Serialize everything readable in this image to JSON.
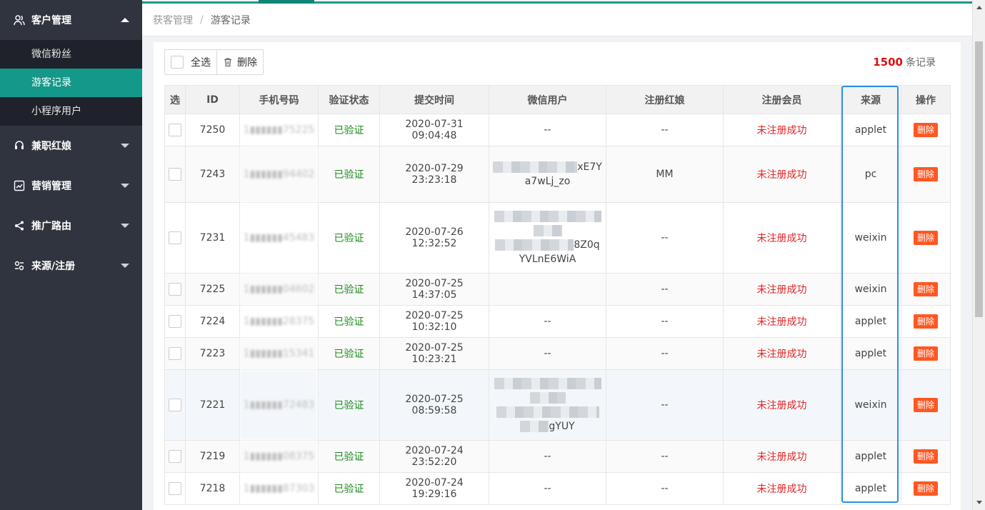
{
  "colors": {
    "sidebar_bg": "#30343f",
    "submenu_bg": "#1f222a",
    "accent": "#14988a",
    "verified": "#1a8a1a",
    "unregistered": "#e42525",
    "delete_btn": "#ff5722",
    "highlight": "#2a8fe6"
  },
  "sidebar": {
    "groups": [
      {
        "label": "客户管理",
        "icon": "users-icon",
        "expanded": true,
        "items": [
          {
            "label": "微信粉丝"
          },
          {
            "label": "游客记录",
            "active": true
          },
          {
            "label": "小程序用户"
          }
        ]
      },
      {
        "label": "兼职红娘",
        "icon": "headset-icon",
        "expanded": false
      },
      {
        "label": "营销管理",
        "icon": "chart-icon",
        "expanded": false
      },
      {
        "label": "推广路由",
        "icon": "share-icon",
        "expanded": false
      },
      {
        "label": "来源/注册",
        "icon": "source-icon",
        "expanded": false
      }
    ]
  },
  "breadcrumb": {
    "parent": "获客管理",
    "separator": "/",
    "current": "游客记录"
  },
  "toolbar": {
    "select_all": "全选",
    "delete": "删除"
  },
  "records": {
    "count": "1500",
    "suffix": "条记录"
  },
  "table": {
    "headers": [
      "选",
      "ID",
      "手机号码",
      "验证状态",
      "提交时间",
      "微信用户",
      "注册红娘",
      "注册会员",
      "来源",
      "操作"
    ],
    "rows": [
      {
        "id": "7250",
        "phone": "1▮▮▮▮▮▮75225",
        "status": "已验证",
        "time": "2020-07-31 09:04:48",
        "wechat": "--",
        "matchmaker": "--",
        "member": "未注册成功",
        "source": "applet",
        "action": "删除"
      },
      {
        "id": "7243",
        "phone": "1▮▮▮▮▮▮94402",
        "status": "已验证",
        "time": "2020-07-29 23:23:18",
        "wechat_tail1": "xE7Y",
        "wechat_tail2": "a7wLj_zo",
        "matchmaker": "MM",
        "member": "未注册成功",
        "source": "pc",
        "action": "删除"
      },
      {
        "id": "7231",
        "phone": "1▮▮▮▮▮▮45483",
        "status": "已验证",
        "time": "2020-07-26 12:32:52",
        "wechat_tail1": "8Z0q",
        "wechat_tail2": "YVLnE6WiA",
        "matchmaker": "--",
        "member": "未注册成功",
        "source": "weixin",
        "action": "删除"
      },
      {
        "id": "7225",
        "phone": "1▮▮▮▮▮▮04602",
        "status": "已验证",
        "time": "2020-07-25 14:37:05",
        "wechat": "",
        "matchmaker": "--",
        "member": "未注册成功",
        "source": "weixin",
        "action": "删除"
      },
      {
        "id": "7224",
        "phone": "1▮▮▮▮▮▮28375",
        "status": "已验证",
        "time": "2020-07-25 10:32:10",
        "wechat": "--",
        "matchmaker": "--",
        "member": "未注册成功",
        "source": "applet",
        "action": "删除"
      },
      {
        "id": "7223",
        "phone": "1▮▮▮▮▮▮15341",
        "status": "已验证",
        "time": "2020-07-25 10:23:21",
        "wechat": "--",
        "matchmaker": "--",
        "member": "未注册成功",
        "source": "applet",
        "action": "删除"
      },
      {
        "id": "7221",
        "phone": "1▮▮▮▮▮▮72483",
        "status": "已验证",
        "time": "2020-07-25 08:59:58",
        "wechat_tail1": "",
        "wechat_tail2": "gYUY",
        "matchmaker": "--",
        "member": "未注册成功",
        "source": "weixin",
        "action": "删除"
      },
      {
        "id": "7219",
        "phone": "1▮▮▮▮▮▮08375",
        "status": "已验证",
        "time": "2020-07-24 23:52:20",
        "wechat": "--",
        "matchmaker": "--",
        "member": "未注册成功",
        "source": "applet",
        "action": "删除"
      },
      {
        "id": "7218",
        "phone": "1▮▮▮▮▮▮87303",
        "status": "已验证",
        "time": "2020-07-24 19:29:16",
        "wechat": "--",
        "matchmaker": "--",
        "member": "未注册成功",
        "source": "applet",
        "action": "删除"
      }
    ]
  }
}
